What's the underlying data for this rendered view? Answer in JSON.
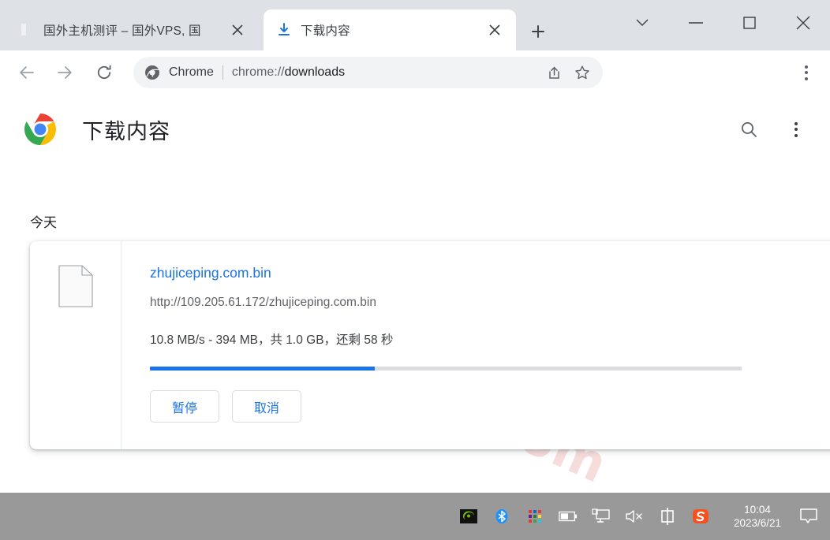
{
  "window": {
    "controls": [
      {
        "name": "tab-search-chevron",
        "icon": "chevron-down-icon"
      },
      {
        "name": "minimize",
        "icon": "minimize-icon"
      },
      {
        "name": "maximize",
        "icon": "maximize-icon"
      },
      {
        "name": "close",
        "icon": "close-icon"
      }
    ]
  },
  "tabs": [
    {
      "title": "国外主机测评 – 国外VPS, 国",
      "favicon": "red-stamp-favicon",
      "active": false,
      "close_label": "×"
    },
    {
      "title": "下载内容",
      "favicon": "download-arrow-icon",
      "active": true,
      "close_label": "×"
    }
  ],
  "new_tab_label": "+",
  "toolbar": {
    "back_icon": "arrow-left-icon",
    "forward_icon": "arrow-right-icon",
    "reload_icon": "reload-icon",
    "omnibox": {
      "scheme_icon": "chrome-logo-icon",
      "scheme_label": "Chrome",
      "url_prefix": "chrome://",
      "url_main": "downloads",
      "share_icon": "share-icon",
      "bookmark_icon": "star-icon"
    },
    "menu_icon": "three-dot-menu-icon"
  },
  "page": {
    "watermark": "zhujiceping.com",
    "logo": "chrome-logo",
    "title": "下载内容",
    "search_icon": "search-icon",
    "more_icon": "three-dot-menu-icon",
    "date_group": "今天",
    "download": {
      "file_icon": "generic-file-icon",
      "file_name": "zhujiceping.com.bin",
      "url": "http://109.205.61.172/zhujiceping.com.bin",
      "status": "10.8 MB/s - 394 MB，共 1.0 GB，还剩 58 秒",
      "speed": "10.8 MB/s",
      "downloaded": "394 MB",
      "total": "1.0 GB",
      "time_remaining": "58 秒",
      "progress_percent": 38,
      "progress_color": "#1a73e8",
      "pause_label": "暂停",
      "cancel_label": "取消"
    }
  },
  "taskbar": {
    "background": "#999999",
    "tray_icons": [
      {
        "name": "nvidia-icon"
      },
      {
        "name": "bluetooth-icon"
      },
      {
        "name": "color-grid-icon"
      },
      {
        "name": "battery-icon"
      },
      {
        "name": "network-monitor-icon"
      },
      {
        "name": "speaker-muted-icon"
      },
      {
        "name": "ime-chinese-icon",
        "label": "中"
      },
      {
        "name": "sogou-icon",
        "label": "S"
      }
    ],
    "clock_time": "10:04",
    "clock_date": "2023/6/21",
    "notification_icon": "notification-bubble-icon"
  }
}
